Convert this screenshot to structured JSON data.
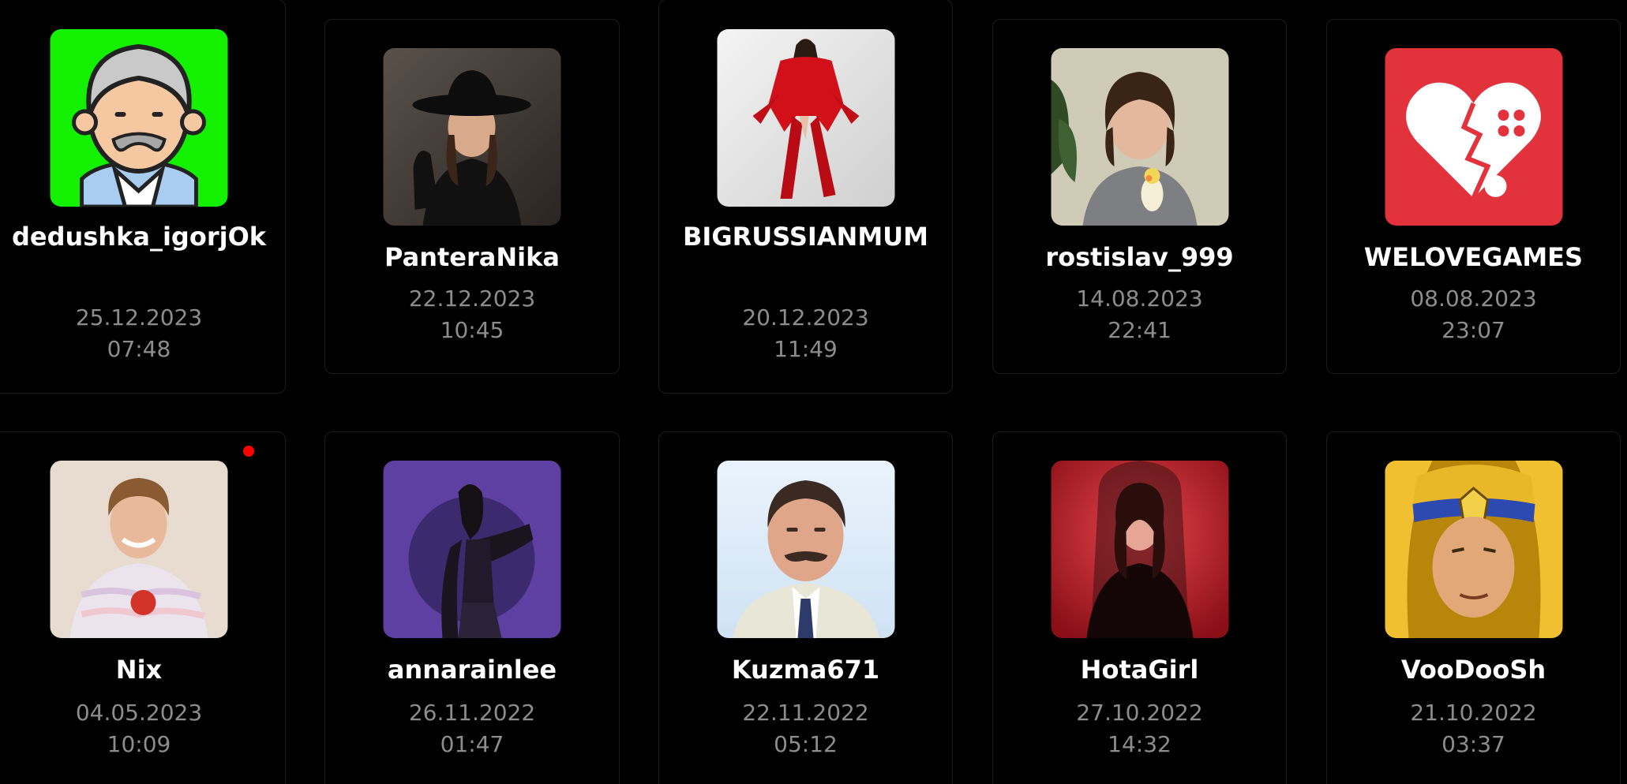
{
  "users": [
    {
      "username": "dedushka_igorjOk",
      "date": "25.12.2023",
      "time": "07:48",
      "avatar": "old-man-cartoon-avatar"
    },
    {
      "username": "PanteraNika",
      "date": "22.12.2023",
      "time": "10:45",
      "avatar": "woman-black-hat-photo"
    },
    {
      "username": "BIGRUSSIANMUM",
      "date": "20.12.2023",
      "time": "11:49",
      "avatar": "woman-red-coat-photo"
    },
    {
      "username": "rostislav_999",
      "date": "14.08.2023",
      "time": "22:41",
      "avatar": "boy-with-parrot-photo"
    },
    {
      "username": "WELOVEGAMES",
      "date": "08.08.2023",
      "time": "23:07",
      "avatar": "heart-gamepad-logo"
    },
    {
      "username": "Nix",
      "date": "04.05.2023",
      "time": "10:09",
      "avatar": "young-man-apple-photo",
      "online": true
    },
    {
      "username": "annarainlee",
      "date": "26.11.2022",
      "time": "01:47",
      "avatar": "purple-woman-illustration"
    },
    {
      "username": "Kuzma671",
      "date": "22.11.2022",
      "time": "05:12",
      "avatar": "man-mustache-suit-photo"
    },
    {
      "username": "HotaGirl",
      "date": "27.10.2022",
      "time": "14:32",
      "avatar": "woman-red-light-photo"
    },
    {
      "username": "VooDooSh",
      "date": "21.10.2022",
      "time": "03:37",
      "avatar": "golden-hero-portrait"
    }
  ],
  "colors": {
    "background": "#000000",
    "card_border": "#1c1c1e",
    "username": "#ffffff",
    "timestamp": "#8d8d8d",
    "online_dot": "#ff0000"
  }
}
